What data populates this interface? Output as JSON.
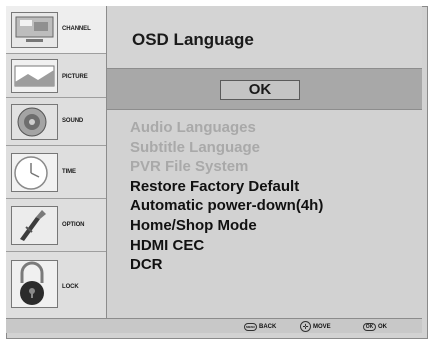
{
  "sidebar": {
    "items": [
      {
        "label": "CHANNEL",
        "icon": "channel-icon",
        "active": true
      },
      {
        "label": "PICTURE",
        "icon": "picture-icon",
        "active": false
      },
      {
        "label": "SOUND",
        "icon": "sound-icon",
        "active": false
      },
      {
        "label": "TIME",
        "icon": "clock-icon",
        "active": false
      },
      {
        "label": "OPTION",
        "icon": "option-icon",
        "active": false
      },
      {
        "label": "LOCK",
        "icon": "lock-icon",
        "active": false
      }
    ]
  },
  "main": {
    "title": "OSD Language",
    "ok_label": "OK",
    "menu": [
      {
        "label": "Audio Languages",
        "enabled": false
      },
      {
        "label": "Subtitle Language",
        "enabled": false
      },
      {
        "label": "PVR File System",
        "enabled": false
      },
      {
        "label": "Restore Factory Default",
        "enabled": true
      },
      {
        "label": "Automatic power-down(4h)",
        "enabled": true
      },
      {
        "label": "Home/Shop Mode",
        "enabled": true
      },
      {
        "label": "HDMI CEC",
        "enabled": true
      },
      {
        "label": "DCR",
        "enabled": true
      }
    ]
  },
  "footer": {
    "hints": [
      {
        "icon": "menu-icon",
        "icon_text": "MENU",
        "label": "BACK"
      },
      {
        "icon": "dpad-icon",
        "icon_text": "✛",
        "label": "MOVE"
      },
      {
        "icon": "ok-icon",
        "icon_text": "OK",
        "label": "OK"
      }
    ]
  },
  "colors": {
    "panel": "#d2d2d2",
    "highlight": "#a8a8a8",
    "text": "#111111",
    "disabled_text": "#a9a9a9"
  }
}
